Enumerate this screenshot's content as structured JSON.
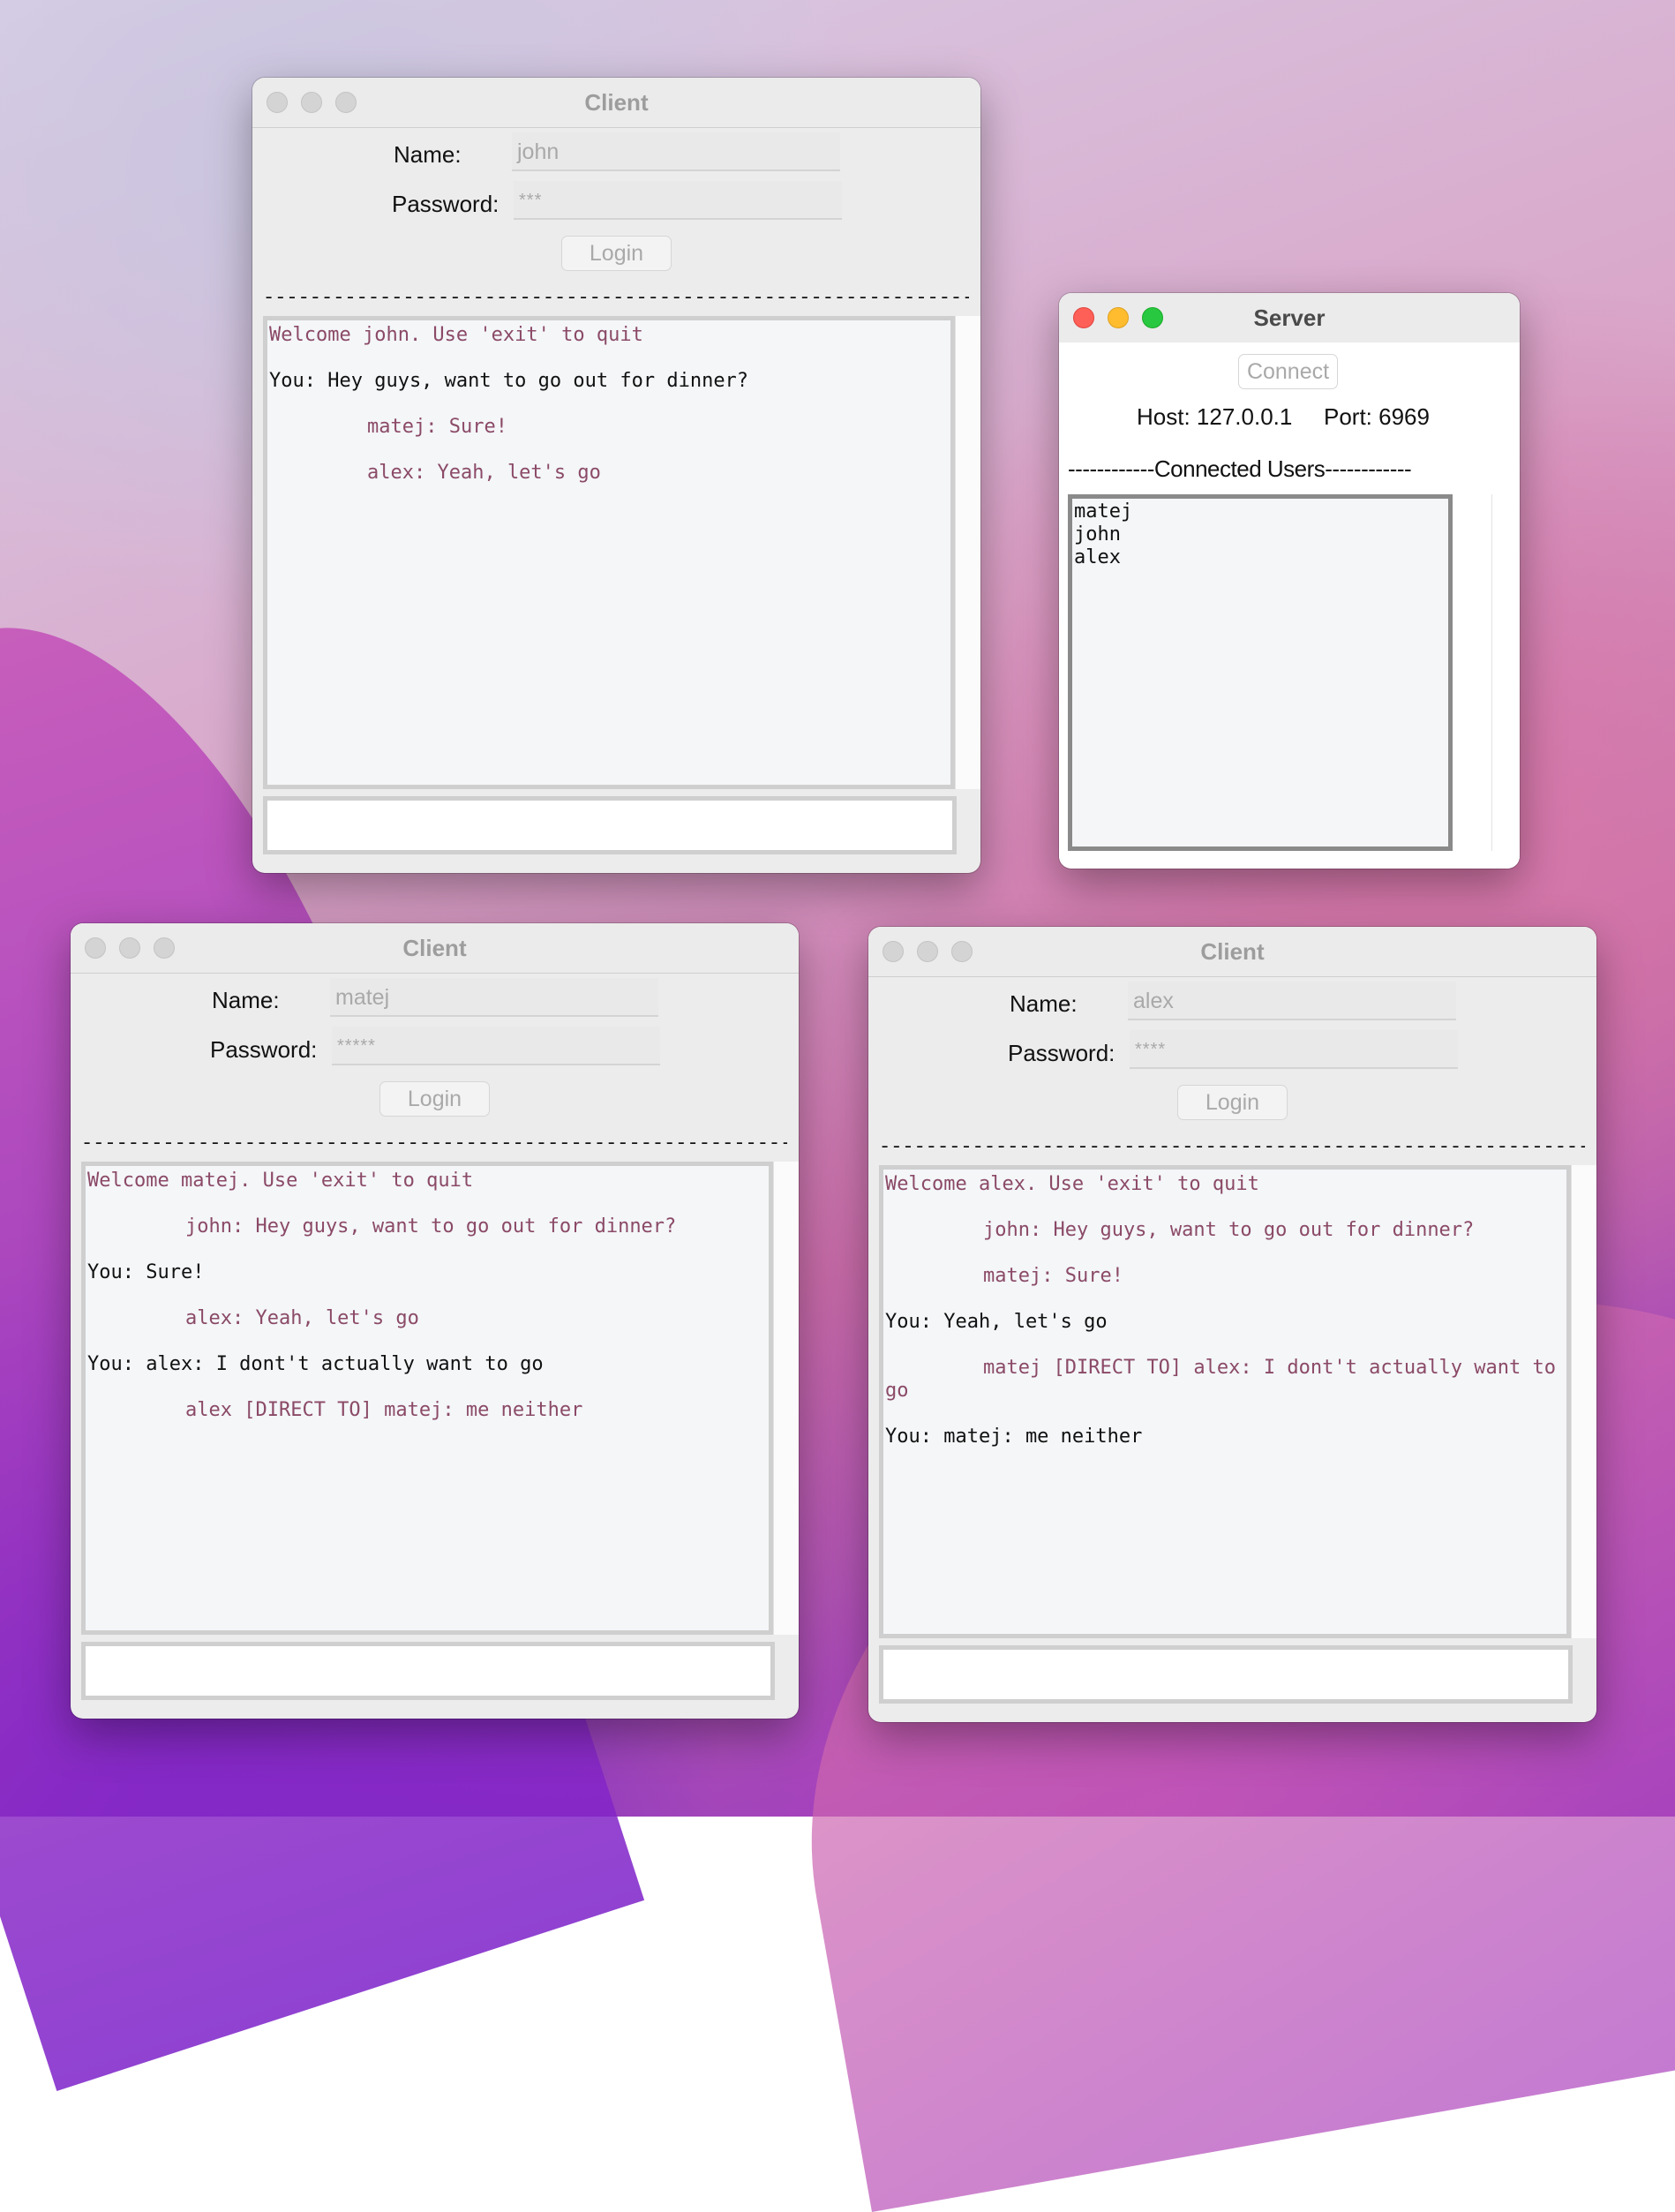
{
  "desktop": {
    "colors": {
      "accent_text": "#8b4a67",
      "traffic_red": "#fe5f57",
      "traffic_yellow": "#febc2e",
      "traffic_green": "#28c840"
    }
  },
  "client_john": {
    "title": "Client",
    "name_label": "Name:",
    "name_value": "john",
    "password_label": "Password:",
    "password_value": "***",
    "login_label": "Login",
    "separator": "------------------------------------------------------------------------------------",
    "messages": [
      {
        "kind": "sys",
        "text": "Welcome john. Use 'exit' to quit"
      },
      {
        "kind": "self",
        "text": "You: Hey guys, want to go out for dinner?"
      },
      {
        "kind": "other",
        "text": "matej: Sure!"
      },
      {
        "kind": "other",
        "text": "alex: Yeah, let's go"
      }
    ],
    "input_value": ""
  },
  "server": {
    "title": "Server",
    "connect_label": "Connect",
    "host_label": "Host: 127.0.0.1",
    "port_label": "Port: 6969",
    "connected_header": "------------Connected Users------------",
    "users": [
      "matej",
      "john",
      "alex"
    ]
  },
  "client_matej": {
    "title": "Client",
    "name_label": "Name:",
    "name_value": "matej",
    "password_label": "Password:",
    "password_value": "*****",
    "login_label": "Login",
    "separator": "------------------------------------------------------------------------------------",
    "messages": [
      {
        "kind": "sys",
        "text": "Welcome matej. Use 'exit' to quit"
      },
      {
        "kind": "other",
        "text": "john: Hey guys, want to go out for dinner?"
      },
      {
        "kind": "self",
        "text": "You: Sure!"
      },
      {
        "kind": "other",
        "text": "alex: Yeah, let's go"
      },
      {
        "kind": "self",
        "text": "You: alex: I dont't actually want to go"
      },
      {
        "kind": "other",
        "text": "alex [DIRECT TO] matej: me neither"
      }
    ],
    "input_value": ""
  },
  "client_alex": {
    "title": "Client",
    "name_label": "Name:",
    "name_value": "alex",
    "password_label": "Password:",
    "password_value": "****",
    "login_label": "Login",
    "separator": "------------------------------------------------------------------------------------",
    "messages": [
      {
        "kind": "sys",
        "text": "Welcome alex. Use 'exit' to quit"
      },
      {
        "kind": "other",
        "text": "john: Hey guys, want to go out for dinner?"
      },
      {
        "kind": "other",
        "text": "matej: Sure!"
      },
      {
        "kind": "self",
        "text": "You: Yeah, let's go"
      },
      {
        "kind": "other wrap",
        "text": "matej [DIRECT TO] alex: I dont't actually want to go"
      },
      {
        "kind": "self",
        "text": "You: matej: me neither"
      }
    ],
    "input_value": ""
  }
}
